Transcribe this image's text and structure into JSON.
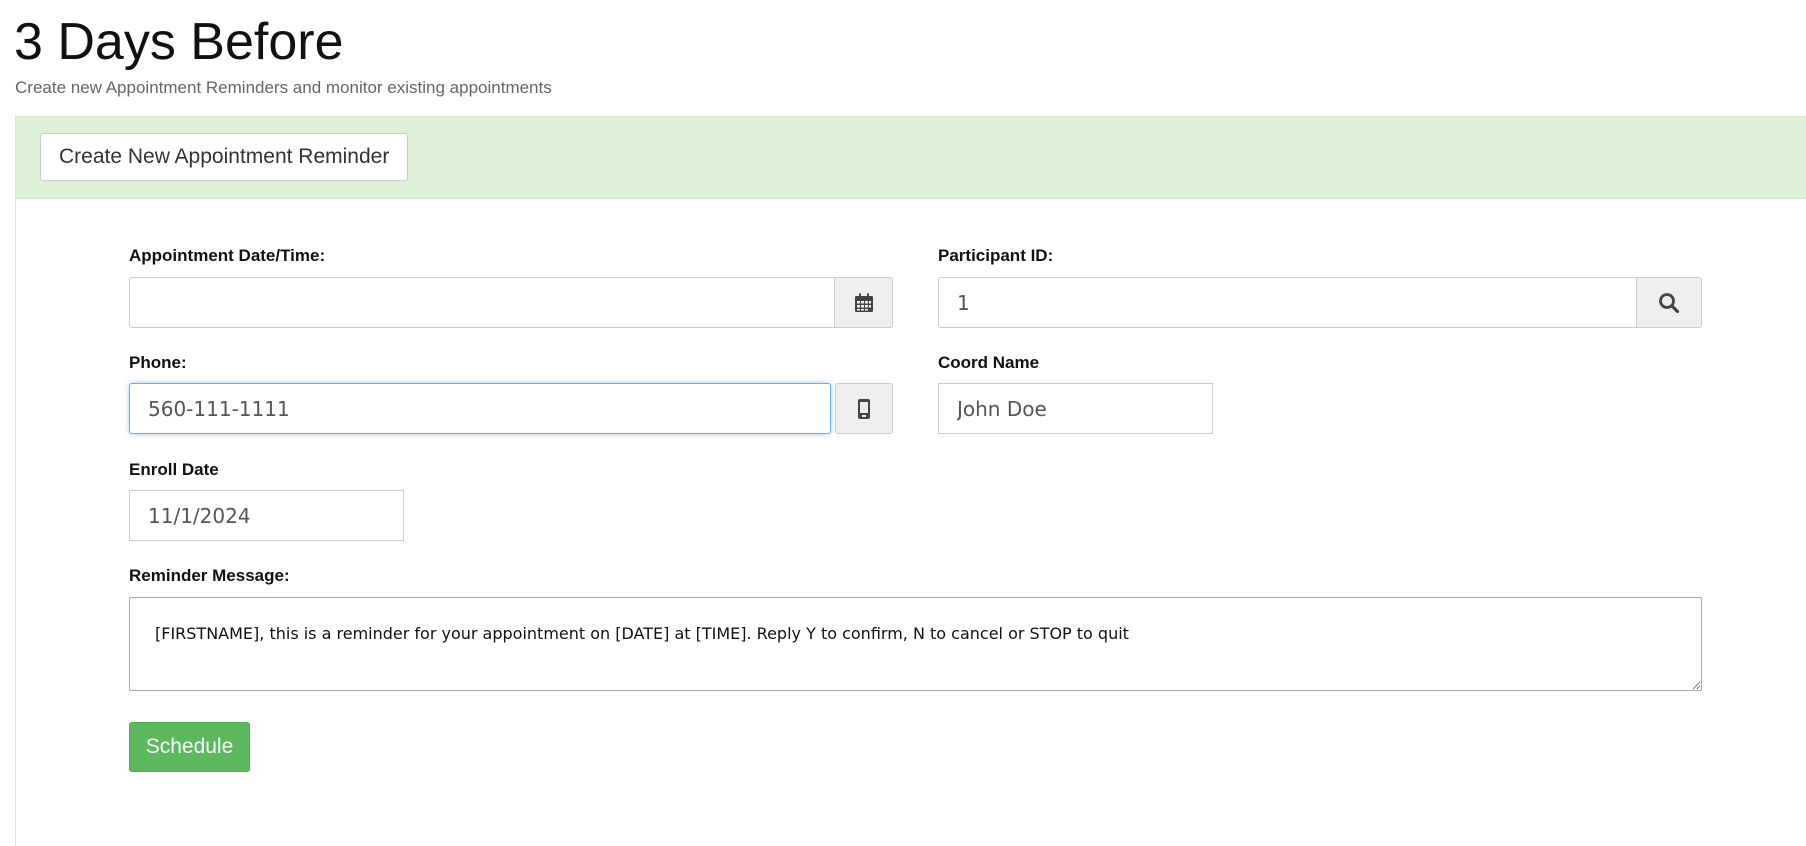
{
  "header": {
    "title": "3 Days Before",
    "subtitle": "Create new Appointment Reminders and monitor existing appointments"
  },
  "panel": {
    "create_button_label": "Create New Appointment Reminder"
  },
  "form": {
    "appointment": {
      "label": "Appointment Date/Time:",
      "value": "",
      "icon": "calendar-icon"
    },
    "participant": {
      "label": "Participant ID:",
      "value": "1",
      "icon": "search-icon"
    },
    "phone": {
      "label": "Phone:",
      "value": "560-111-1111",
      "icon": "mobile-phone-icon"
    },
    "coord_name": {
      "label": "Coord Name",
      "value": "John Doe"
    },
    "enroll_date": {
      "label": "Enroll Date",
      "value": "11/1/2024"
    },
    "reminder": {
      "label": "Reminder Message:",
      "value": "[FIRSTNAME], this is a reminder for your appointment on [DATE] at [TIME]. Reply Y to confirm, N to cancel or STOP to quit"
    },
    "schedule_label": "Schedule"
  },
  "colors": {
    "panel_heading_bg": "#dff0d8",
    "schedule_button_bg": "#5cb85c",
    "focus_border": "#66afe9"
  }
}
